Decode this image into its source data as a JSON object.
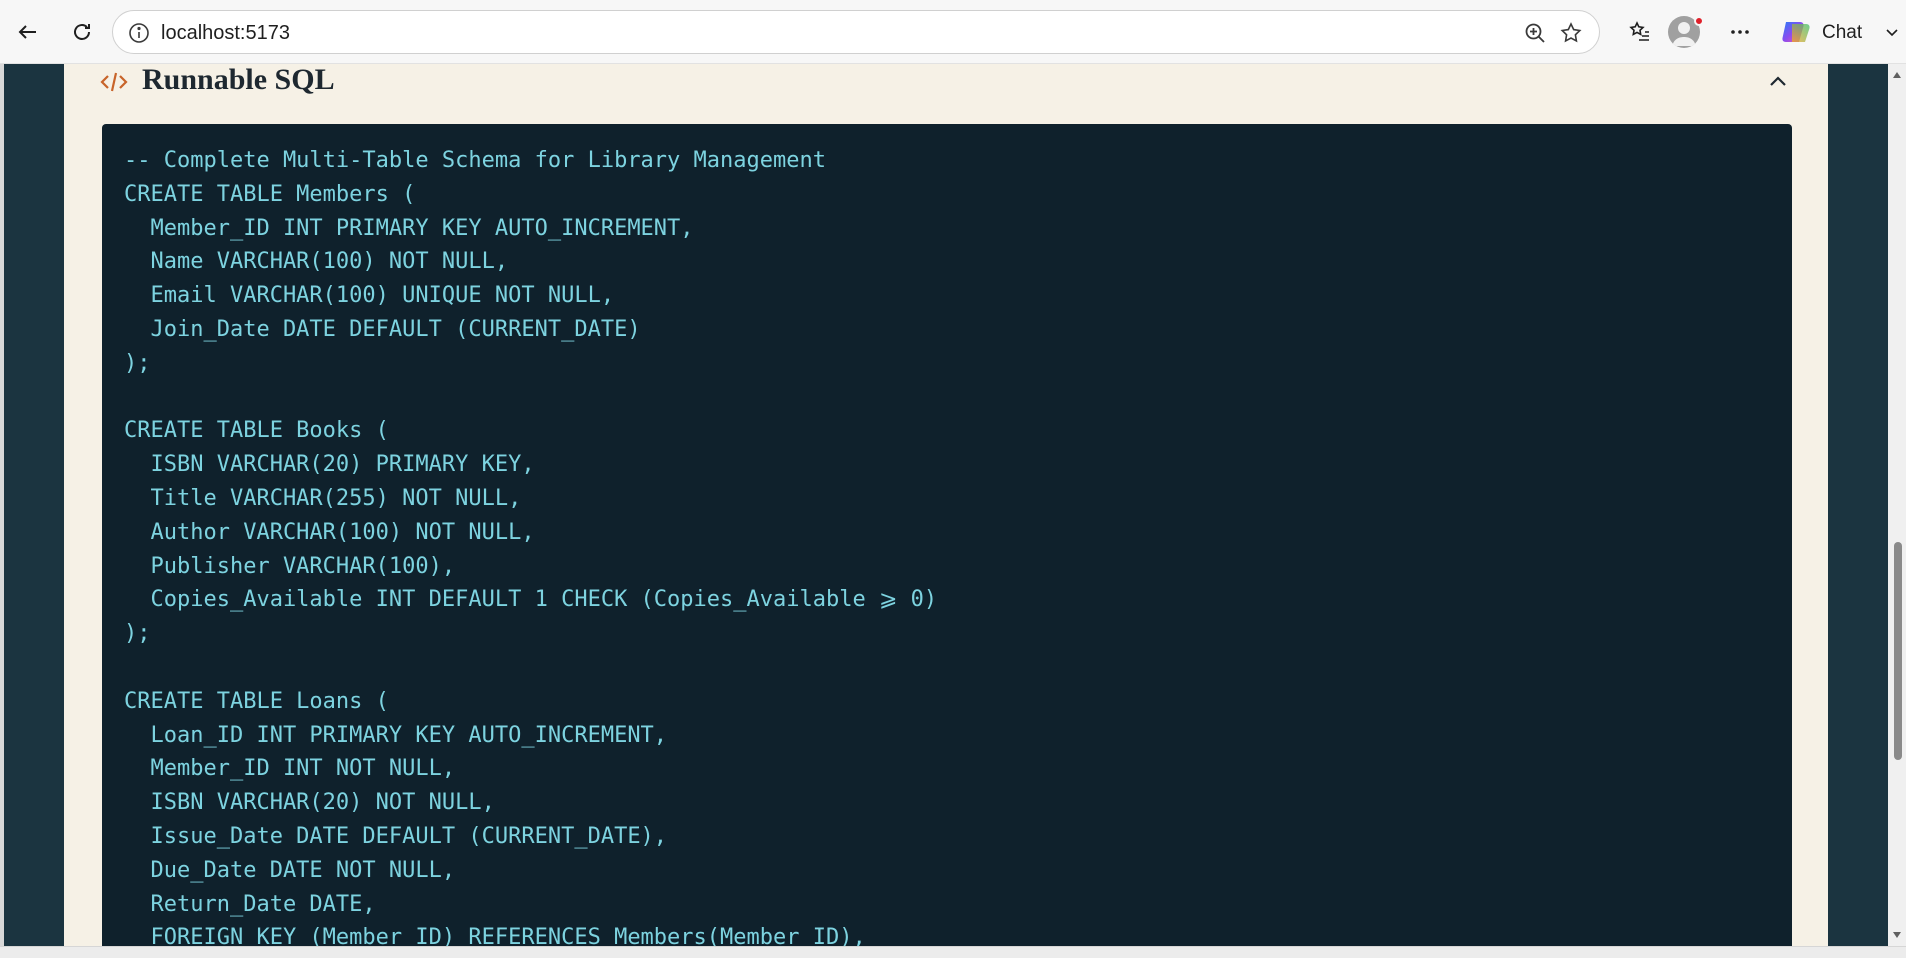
{
  "browser": {
    "url": "localhost:5173",
    "chat_label": "Chat",
    "icons": {
      "back": "back-arrow-icon",
      "reload": "reload-icon",
      "info": "info-icon",
      "zoom": "zoom-in-icon",
      "favorite": "star-icon",
      "favorites_list": "favorites-list-icon",
      "profile": "avatar",
      "more": "more-icon",
      "copilot": "copilot-icon"
    }
  },
  "section": {
    "title": "Runnable SQL",
    "icon": "code-icon",
    "collapse_icon": "chevron-up-icon"
  },
  "code": {
    "lines": [
      "-- Complete Multi-Table Schema for Library Management",
      "CREATE TABLE Members (",
      "  Member_ID INT PRIMARY KEY AUTO_INCREMENT,",
      "  Name VARCHAR(100) NOT NULL,",
      "  Email VARCHAR(100) UNIQUE NOT NULL,",
      "  Join_Date DATE DEFAULT (CURRENT_DATE)",
      ");",
      "",
      "CREATE TABLE Books (",
      "  ISBN VARCHAR(20) PRIMARY KEY,",
      "  Title VARCHAR(255) NOT NULL,",
      "  Author VARCHAR(100) NOT NULL,",
      "  Publisher VARCHAR(100),",
      "  Copies_Available INT DEFAULT 1 CHECK (Copies_Available ⩾ 0)",
      ");",
      "",
      "CREATE TABLE Loans (",
      "  Loan_ID INT PRIMARY KEY AUTO_INCREMENT,",
      "  Member_ID INT NOT NULL,",
      "  ISBN VARCHAR(20) NOT NULL,",
      "  Issue_Date DATE DEFAULT (CURRENT_DATE),",
      "  Due_Date DATE NOT NULL,",
      "  Return_Date DATE,",
      "  FOREIGN KEY (Member_ID) REFERENCES Members(Member_ID),"
    ]
  },
  "colors": {
    "page_bg": "#1b3440",
    "card_bg": "#f6f1e6",
    "code_bg": "#0f212c",
    "code_text": "#7dd3e0",
    "accent_icon": "#c8642a"
  }
}
